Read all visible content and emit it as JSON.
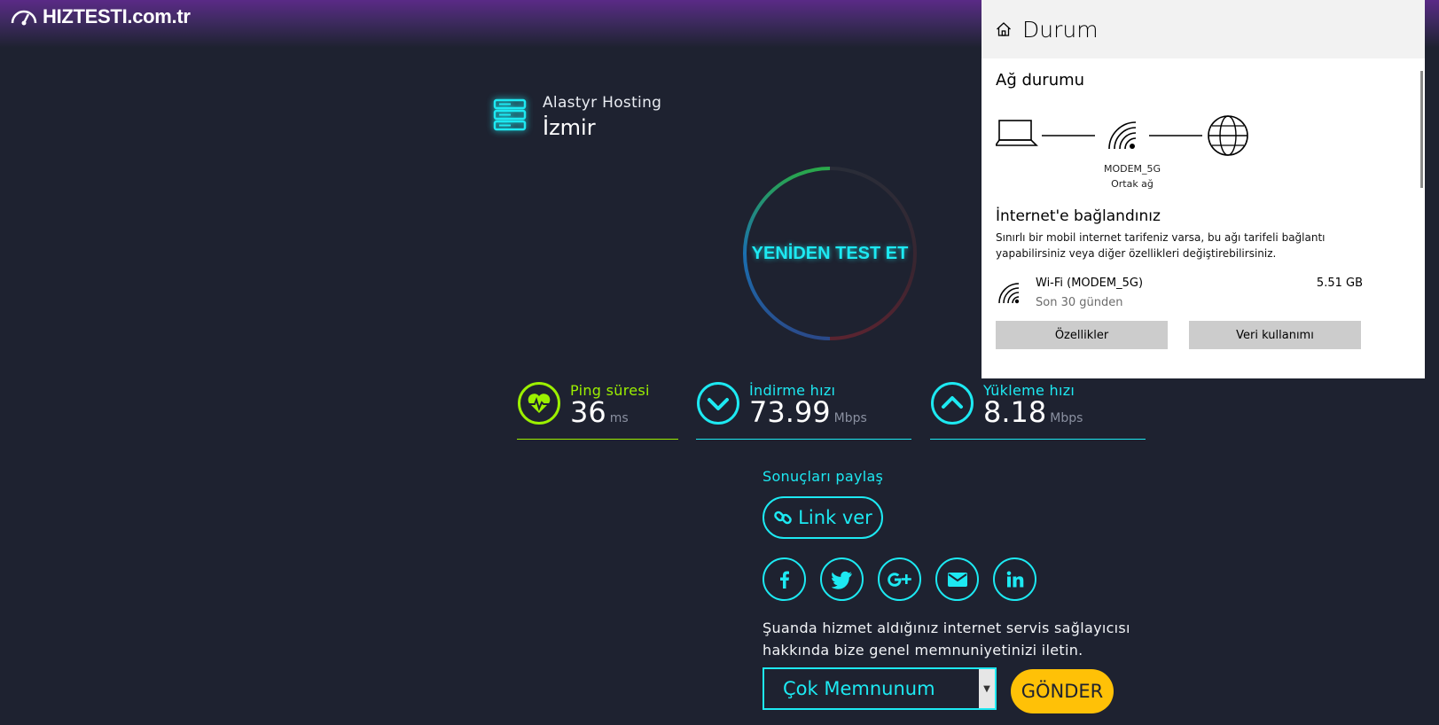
{
  "header": {
    "logo_text": "HIZTESTI.com.tr"
  },
  "server": {
    "name": "Alastyr Hosting",
    "city": "İzmir"
  },
  "test": {
    "retest_label": "YENİDEN TEST ET"
  },
  "metrics": {
    "ping": {
      "label": "Ping süresi",
      "value": "36",
      "unit": "ms",
      "color": "#9cf000"
    },
    "download": {
      "label": "İndirme hızı",
      "value": "73.99",
      "unit": "Mbps",
      "color": "#1de9f2"
    },
    "upload": {
      "label": "Yükleme hızı",
      "value": "8.18",
      "unit": "Mbps",
      "color": "#1de9f2"
    }
  },
  "share": {
    "title": "Sonuçları paylaş",
    "link_label": "Link ver",
    "socials": [
      "facebook-icon",
      "twitter-icon",
      "google-plus-icon",
      "email-icon",
      "linkedin-icon"
    ]
  },
  "survey": {
    "line1": "Şuanda hizmet aldığınız internet servis sağlayıcısı",
    "line2": "hakkında bize genel memnuniyetinizi iletin.",
    "selected": "Çok Memnunum",
    "send_label": "GÖNDER"
  },
  "panel": {
    "title": "Durum",
    "section": "Ağ durumu",
    "modem_name": "MODEM_5G",
    "modem_sub": "Ortak ağ",
    "connected": "İnternet'e bağlandınız",
    "desc": "Sınırlı bir mobil internet tarifeniz varsa, bu ağı tarifeli bağlantı yapabilirsiniz veya diğer özellikleri değiştirebilirsiniz.",
    "wifi_name": "Wi-Fi (MODEM_5G)",
    "wifi_sub": "Son 30 günden",
    "wifi_size": "5.51 GB",
    "btn_properties": "Özellikler",
    "btn_data_usage": "Veri kullanımı"
  },
  "colors": {
    "accent": "#1de9f2",
    "ping": "#9cf000",
    "send": "#ffc107",
    "background": "#1e2230"
  }
}
